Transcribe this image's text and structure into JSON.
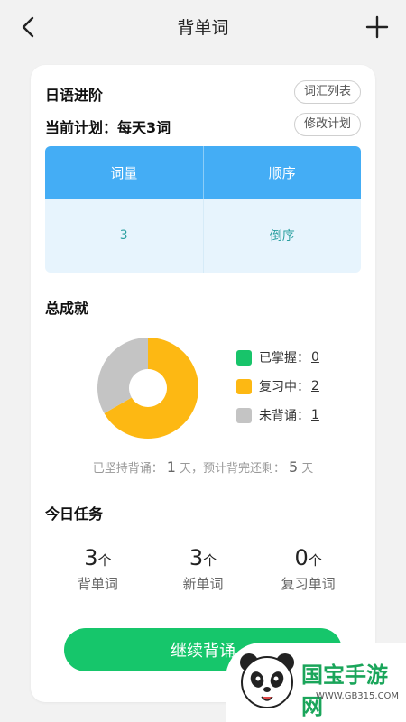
{
  "header": {
    "title": "背单词",
    "back_icon": "chevron-left-icon",
    "add_icon": "plus-icon"
  },
  "book": {
    "name": "日语进阶",
    "list_button": "词汇列表",
    "plan_label": "当前计划：每天3词",
    "edit_button": "修改计划"
  },
  "plan_table": {
    "headers": [
      "词量",
      "顺序"
    ],
    "values": [
      "3",
      "倒序"
    ]
  },
  "achievement": {
    "title": "总成就",
    "legend": [
      {
        "label": "已掌握：",
        "value": "0",
        "color": "#18c46a"
      },
      {
        "label": "复习中：",
        "value": "2",
        "color": "#fdb813"
      },
      {
        "label": "未背诵：",
        "value": "1",
        "color": "#c4c4c4"
      }
    ],
    "persist_prefix": "已坚持背诵：",
    "persist_days": "1",
    "persist_mid": "天，预计背完还剩：",
    "remain_days": "5",
    "persist_suffix": "天"
  },
  "chart_data": {
    "type": "pie",
    "categories": [
      "已掌握",
      "复习中",
      "未背诵"
    ],
    "values": [
      0,
      2,
      1
    ],
    "colors": [
      "#18c46a",
      "#fdb813",
      "#c4c4c4"
    ]
  },
  "today": {
    "title": "今日任务",
    "tasks": [
      {
        "num": "3",
        "unit": "个",
        "label": "背单词"
      },
      {
        "num": "3",
        "unit": "个",
        "label": "新单词"
      },
      {
        "num": "0",
        "unit": "个",
        "label": "复习单词"
      }
    ]
  },
  "continue_button": "继续背诵",
  "watermark": {
    "text": "国宝手游网",
    "url": "WWW.GB315.COM"
  },
  "colors": {
    "accent_blue": "#44adf5",
    "accent_green": "#16c66b"
  }
}
